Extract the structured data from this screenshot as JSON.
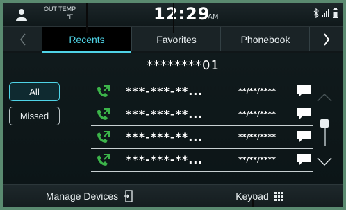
{
  "status_bar": {
    "out_temp_label": "OUT TEMP",
    "out_temp_unit": "°F",
    "time": "12:29",
    "ampm": "AM",
    "icons": [
      "person-icon",
      "bluetooth-icon",
      "signal-icon",
      "battery-icon"
    ]
  },
  "tabs": {
    "items": [
      {
        "label": "Recents",
        "active": true
      },
      {
        "label": "Favorites",
        "active": false
      },
      {
        "label": "Phonebook",
        "active": false
      }
    ]
  },
  "contact": {
    "number": "********01"
  },
  "filters": [
    {
      "label": "All",
      "active": true
    },
    {
      "label": "Missed",
      "active": false
    }
  ],
  "calls": [
    {
      "number": "***-***-**...",
      "date": "**/**/****"
    },
    {
      "number": "***-***-**...",
      "date": "**/**/****"
    },
    {
      "number": "***-***-**...",
      "date": "**/**/****"
    },
    {
      "number": "***-***-**...",
      "date": "**/**/****"
    }
  ],
  "bottom": {
    "manage_devices": "Manage Devices",
    "keypad": "Keypad"
  },
  "colors": {
    "accent": "#4fd3e6",
    "call_icon": "#3cb44a",
    "background": "#0d1719"
  }
}
